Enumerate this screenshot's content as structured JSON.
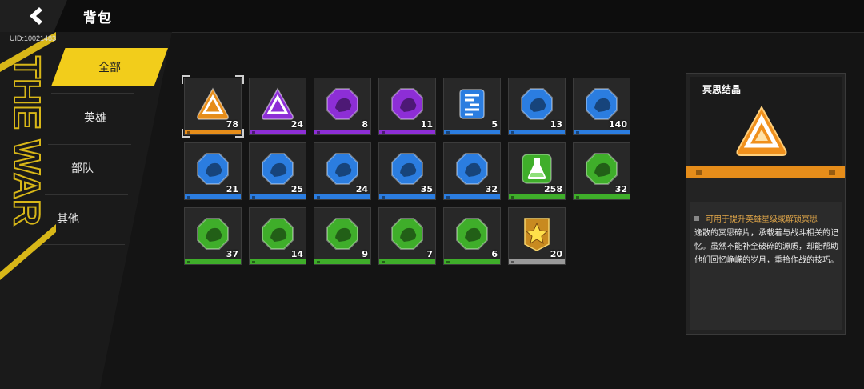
{
  "header": {
    "title": "背包",
    "back_icon": "arrow-left-icon"
  },
  "uid": "UID:10021483",
  "sidebar": {
    "deco_text": "THE WAR",
    "tabs": [
      {
        "label": "全部",
        "active": true
      },
      {
        "label": "英雄",
        "active": false
      },
      {
        "label": "部队",
        "active": false
      },
      {
        "label": "其他",
        "active": false
      }
    ]
  },
  "colors": {
    "accent": "#f2cd1b",
    "orange": "#e68d1a",
    "purple": "#8d2ed6",
    "blue": "#2b7de0",
    "green": "#3fae2a",
    "gray": "#9a9a9a"
  },
  "items": [
    {
      "count": "78",
      "rarity": "orange",
      "icon": "triangle-crystal-icon",
      "selected": true
    },
    {
      "count": "24",
      "rarity": "purple",
      "icon": "triangle-crystal-icon"
    },
    {
      "count": "8",
      "rarity": "purple",
      "icon": "beast-shard-icon"
    },
    {
      "count": "11",
      "rarity": "purple",
      "icon": "beast-shard-icon"
    },
    {
      "count": "5",
      "rarity": "blue",
      "icon": "scroll-icon"
    },
    {
      "count": "13",
      "rarity": "blue",
      "icon": "beast-shard-icon"
    },
    {
      "count": "140",
      "rarity": "blue",
      "icon": "beast-shard-icon"
    },
    {
      "count": "21",
      "rarity": "blue",
      "icon": "beast-shard-icon"
    },
    {
      "count": "25",
      "rarity": "blue",
      "icon": "beast-shard-icon"
    },
    {
      "count": "24",
      "rarity": "blue",
      "icon": "beast-shard-icon"
    },
    {
      "count": "35",
      "rarity": "blue",
      "icon": "beast-shard-icon"
    },
    {
      "count": "32",
      "rarity": "blue",
      "icon": "beast-shard-icon"
    },
    {
      "count": "258",
      "rarity": "green",
      "icon": "potion-flask-icon"
    },
    {
      "count": "32",
      "rarity": "green",
      "icon": "beast-shard-icon"
    },
    {
      "count": "37",
      "rarity": "green",
      "icon": "beast-shard-icon"
    },
    {
      "count": "14",
      "rarity": "green",
      "icon": "beast-shard-icon"
    },
    {
      "count": "9",
      "rarity": "green",
      "icon": "beast-shard-icon"
    },
    {
      "count": "7",
      "rarity": "green",
      "icon": "beast-shard-icon"
    },
    {
      "count": "6",
      "rarity": "green",
      "icon": "beast-shard-icon"
    },
    {
      "count": "20",
      "rarity": "gray",
      "icon": "star-badge-icon"
    }
  ],
  "detail": {
    "name": "冥思结晶",
    "icon": "triangle-crystal-icon",
    "usage": "可用于提升英雄星级或解锁冥思",
    "description": "逸散的冥思碎片，承载着与战斗相关的记忆。虽然不能补全破碎的源质，却能帮助他们回忆峥嵘的岁月，重拾作战的技巧。"
  }
}
